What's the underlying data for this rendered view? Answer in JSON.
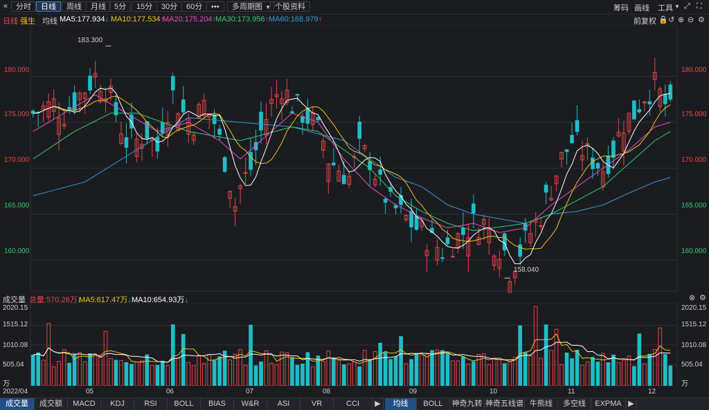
{
  "toolbar": {
    "back_icon": "double-left-arrow-icon",
    "buttons": [
      "分时",
      "日线",
      "周线",
      "月线",
      "5分",
      "15分",
      "30分",
      "60分",
      "•••",
      "多周期图",
      "个股资料"
    ],
    "active": "日线",
    "right": {
      "chips": "筹码",
      "draw": "画线",
      "tools": "工具"
    }
  },
  "legend": {
    "period": "日线",
    "strong": "强生",
    "ma_label": "均线",
    "items": [
      {
        "text": "MA5:177.934",
        "arrow": "↓",
        "color": "#ffffff",
        "arrow_color": "#2ecc71"
      },
      {
        "text": "MA10:177.534",
        "arrow": "↑",
        "color": "#f1c40f",
        "arrow_color": "#e74c3c"
      },
      {
        "text": "MA20:175.204",
        "arrow": "↑",
        "color": "#e84cc7",
        "arrow_color": "#e74c3c"
      },
      {
        "text": "MA30:173.956",
        "arrow": "↑",
        "color": "#2ecc71",
        "arrow_color": "#e74c3c"
      },
      {
        "text": "MA60:168.979",
        "arrow": "↑",
        "color": "#3498db",
        "arrow_color": "#e74c3c"
      }
    ],
    "adjust": "前复权"
  },
  "volume_legend": {
    "label": "成交量",
    "total": "总量:570.26万",
    "total_arrow": "↓",
    "ma5": "MA5:617.47万",
    "ma5_arrow": "↓",
    "ma10": "MA10:654.93万",
    "ma10_arrow": "↓"
  },
  "colors": {
    "up": "#e84545",
    "down": "#1fbdc6",
    "ma5": "#ffffff",
    "ma10": "#f1c40f",
    "ma20": "#e84cc7",
    "ma30": "#2ecc71",
    "ma60": "#3498db",
    "grid": "#2f3036"
  },
  "chart_data": {
    "type": "candlestick",
    "price_axis": {
      "ticks": [
        "180.000",
        "175.000",
        "170.000",
        "165.000",
        "160.000"
      ],
      "min": 157,
      "max": 185
    },
    "annotations": {
      "high": "183.300",
      "low": "158.040"
    },
    "x_labels": [
      "2022/04",
      "05",
      "06",
      "07",
      "08",
      "09",
      "10",
      "11",
      "12"
    ],
    "volume_axis": {
      "ticks": [
        "2020.15",
        "1515.12",
        "1010.08",
        "505.04"
      ],
      "unit": "万",
      "max": 2020.15
    },
    "close_path": [
      [
        0,
        176
      ],
      [
        4,
        177
      ],
      [
        6,
        176
      ],
      [
        9,
        178
      ],
      [
        12,
        180
      ],
      [
        14,
        179
      ],
      [
        16,
        176
      ],
      [
        18,
        173
      ],
      [
        20,
        173
      ],
      [
        22,
        174
      ],
      [
        24,
        172
      ],
      [
        25,
        175
      ],
      [
        27,
        178
      ],
      [
        29,
        176
      ],
      [
        31,
        175
      ],
      [
        33,
        177
      ],
      [
        35,
        175
      ],
      [
        37,
        171
      ],
      [
        39,
        166
      ],
      [
        40,
        168
      ],
      [
        42,
        170
      ],
      [
        44,
        174
      ],
      [
        46,
        177
      ],
      [
        48,
        179
      ],
      [
        50,
        177
      ],
      [
        52,
        176
      ],
      [
        54,
        175
      ],
      [
        56,
        173
      ],
      [
        57,
        171
      ],
      [
        59,
        170
      ],
      [
        61,
        169
      ],
      [
        63,
        172
      ],
      [
        65,
        171
      ],
      [
        67,
        168
      ],
      [
        69,
        166
      ],
      [
        71,
        165
      ],
      [
        73,
        164
      ],
      [
        75,
        163
      ],
      [
        77,
        162
      ],
      [
        79,
        161
      ],
      [
        81,
        162
      ],
      [
        83,
        163
      ],
      [
        85,
        164
      ],
      [
        87,
        164
      ],
      [
        89,
        162
      ],
      [
        91,
        161
      ],
      [
        92,
        159
      ],
      [
        94,
        161
      ],
      [
        96,
        163
      ],
      [
        98,
        165
      ],
      [
        100,
        168
      ],
      [
        102,
        171
      ],
      [
        104,
        173
      ],
      [
        106,
        172
      ],
      [
        108,
        171
      ],
      [
        110,
        170
      ],
      [
        112,
        172
      ],
      [
        114,
        175
      ],
      [
        116,
        176
      ],
      [
        118,
        178
      ],
      [
        120,
        179
      ],
      [
        122,
        177
      ],
      [
        123,
        176
      ]
    ],
    "ma60_path": [
      [
        0,
        167
      ],
      [
        10,
        168.5
      ],
      [
        20,
        172
      ],
      [
        30,
        175.5
      ],
      [
        40,
        175
      ],
      [
        50,
        174.5
      ],
      [
        60,
        173
      ],
      [
        65,
        171
      ],
      [
        70,
        169
      ],
      [
        75,
        168
      ],
      [
        80,
        166
      ],
      [
        85,
        165
      ],
      [
        90,
        164.5
      ],
      [
        95,
        164
      ],
      [
        100,
        165
      ],
      [
        105,
        165.3
      ],
      [
        110,
        166
      ],
      [
        115,
        167.3
      ],
      [
        120,
        168.5
      ],
      [
        123,
        169
      ]
    ],
    "ma30_path": [
      [
        0,
        171
      ],
      [
        8,
        174
      ],
      [
        15,
        176
      ],
      [
        20,
        176
      ],
      [
        30,
        174
      ],
      [
        40,
        173
      ],
      [
        50,
        174.5
      ],
      [
        55,
        174
      ],
      [
        60,
        172
      ],
      [
        65,
        170
      ],
      [
        70,
        167
      ],
      [
        75,
        165.3
      ],
      [
        80,
        164
      ],
      [
        85,
        163.2
      ],
      [
        90,
        163.6
      ],
      [
        95,
        164
      ],
      [
        100,
        165
      ],
      [
        105,
        166.5
      ],
      [
        110,
        168
      ],
      [
        115,
        170.5
      ],
      [
        120,
        173
      ],
      [
        123,
        174
      ]
    ],
    "ma20_path": [
      [
        0,
        174
      ],
      [
        6,
        176
      ],
      [
        12,
        178
      ],
      [
        18,
        176
      ],
      [
        24,
        174
      ],
      [
        30,
        175
      ],
      [
        36,
        173
      ],
      [
        40,
        171
      ],
      [
        46,
        174
      ],
      [
        50,
        176
      ],
      [
        55,
        175
      ],
      [
        60,
        171
      ],
      [
        65,
        168
      ],
      [
        70,
        166
      ],
      [
        75,
        164.6
      ],
      [
        80,
        163.5
      ],
      [
        85,
        164
      ],
      [
        90,
        163
      ],
      [
        95,
        163.5
      ],
      [
        100,
        166
      ],
      [
        105,
        168
      ],
      [
        110,
        170
      ],
      [
        115,
        172
      ],
      [
        120,
        174.5
      ],
      [
        123,
        175
      ]
    ]
  }
}
